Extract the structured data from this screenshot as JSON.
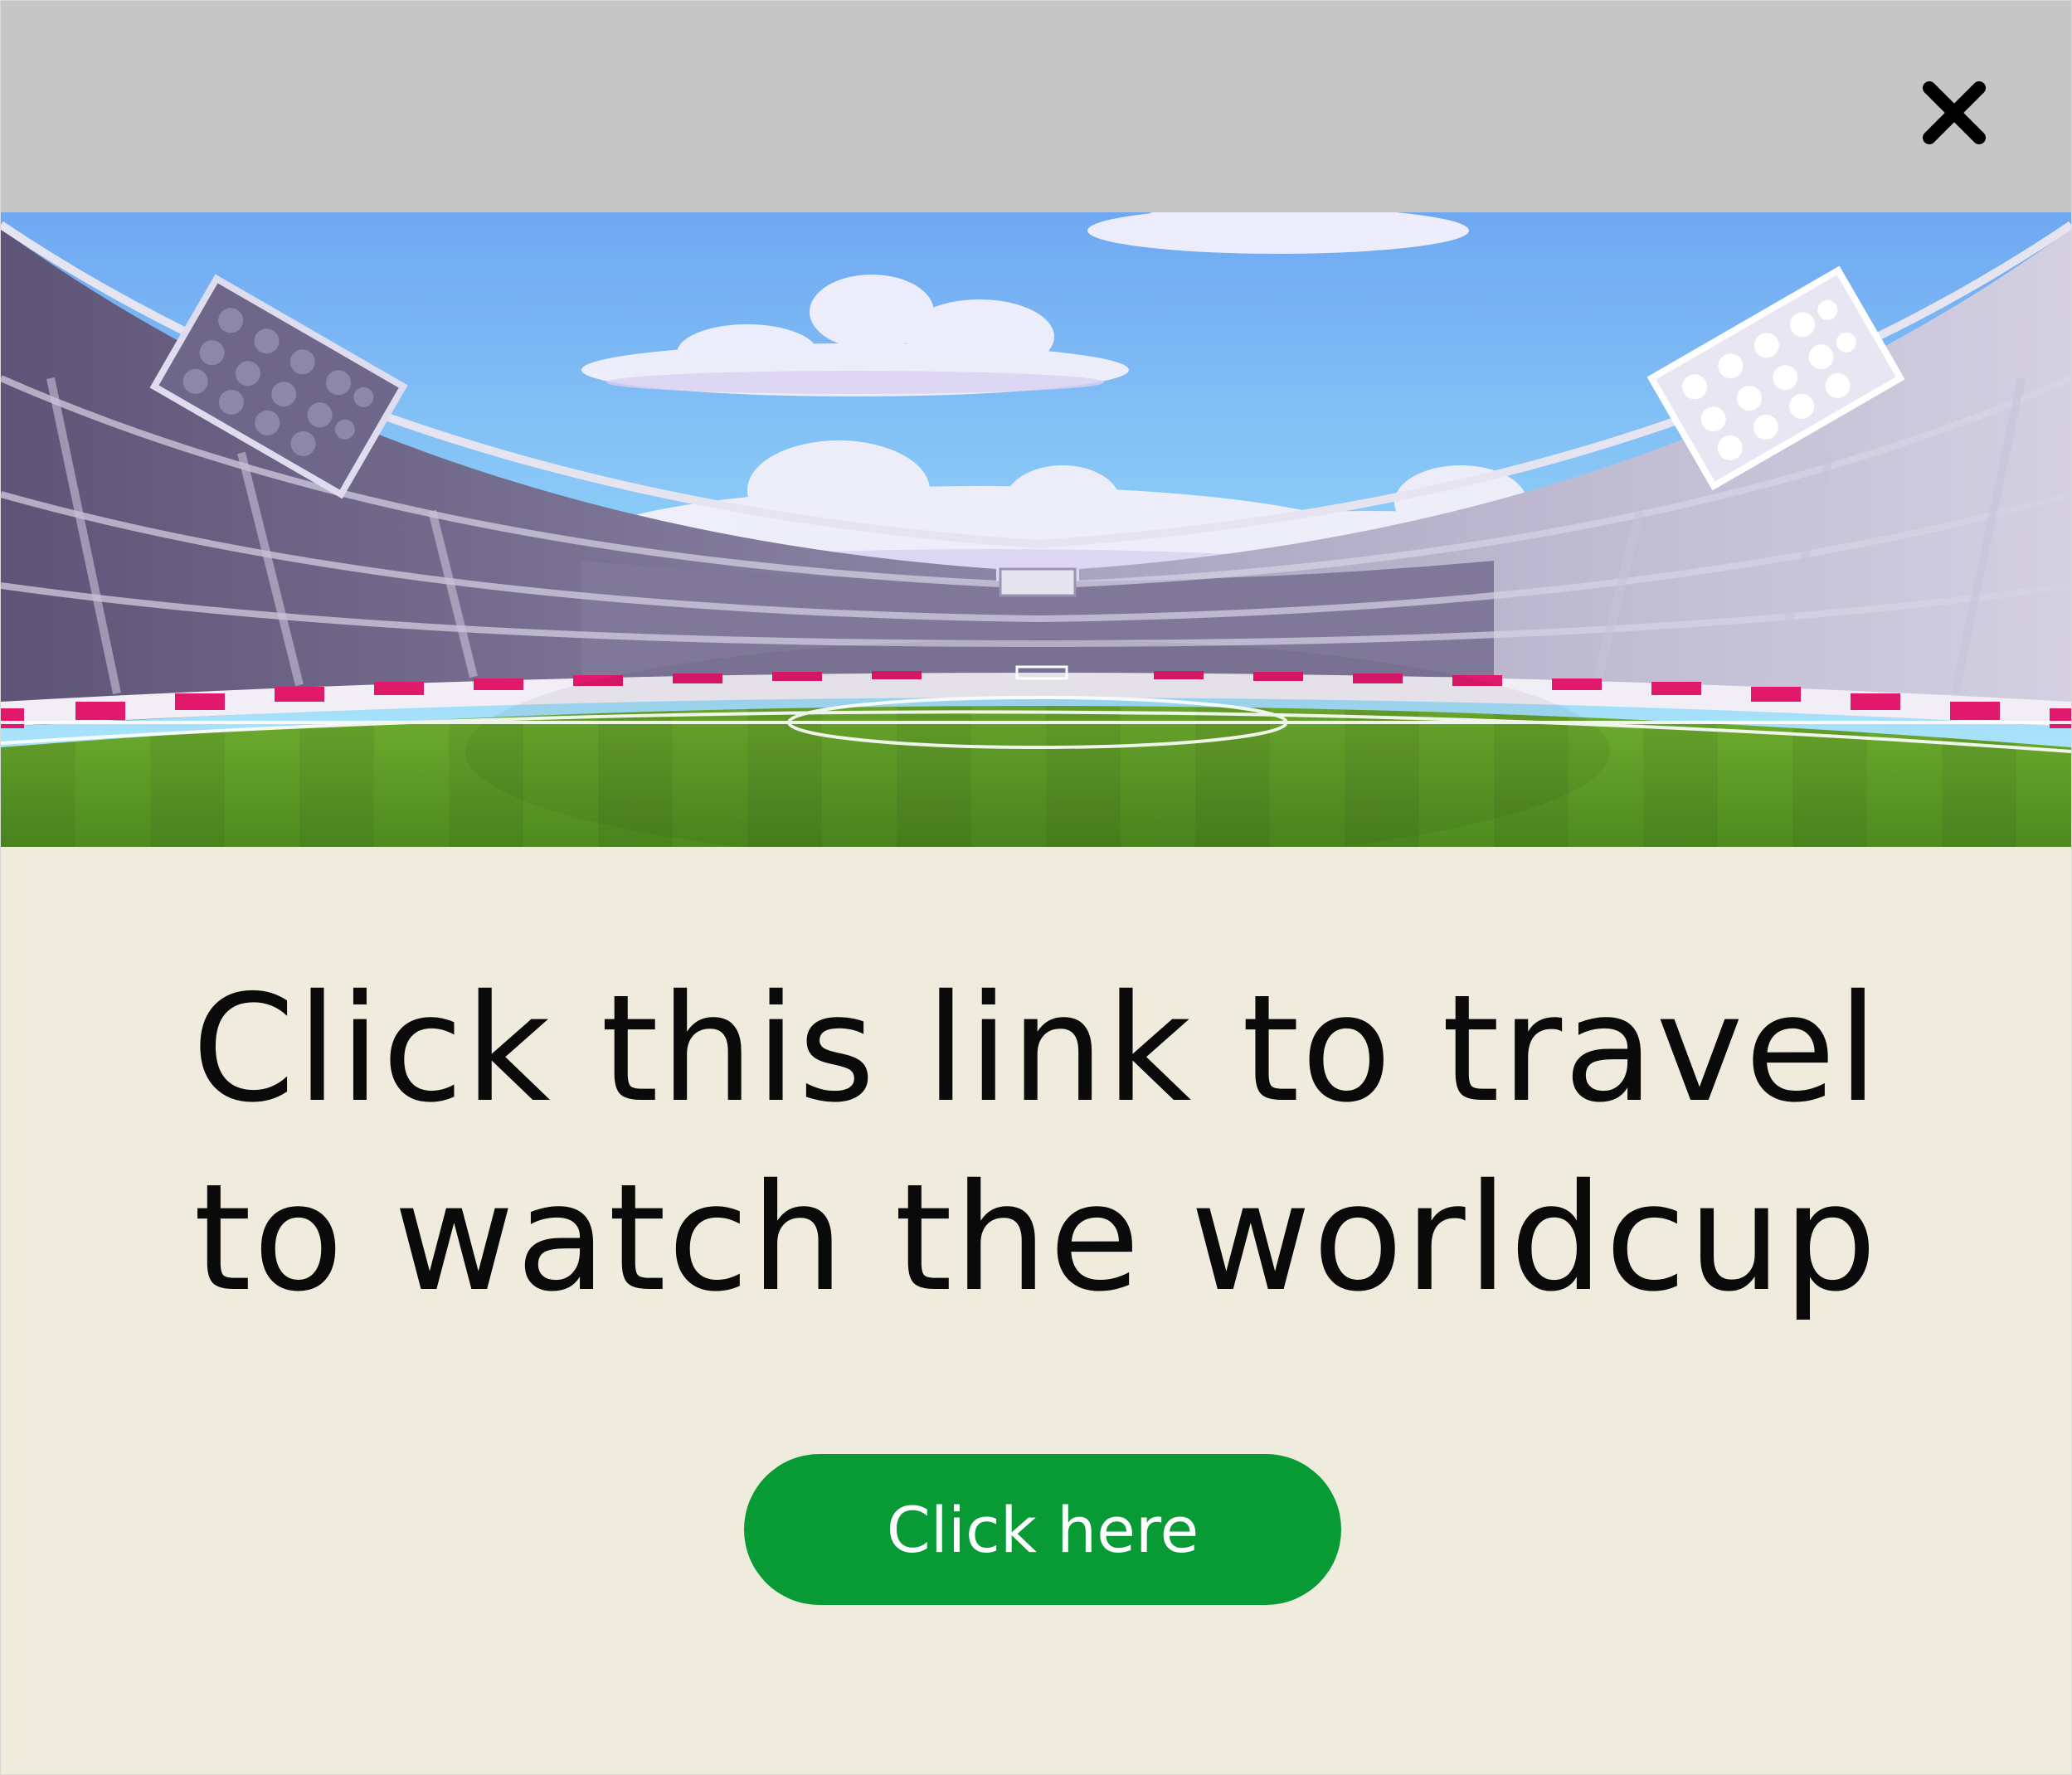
{
  "popup": {
    "headline_line1": "Click this link to travel",
    "headline_line2": "to watch the worldcup",
    "cta_label": "Click here",
    "close_icon": "close-x-icon",
    "banner_image": "stadium-illustration"
  },
  "colors": {
    "topbar": "#c6c6c6",
    "background": "#efecdd",
    "cta": "#079a35",
    "cta_text": "#ffffff",
    "headline": "#0a0a0a"
  }
}
